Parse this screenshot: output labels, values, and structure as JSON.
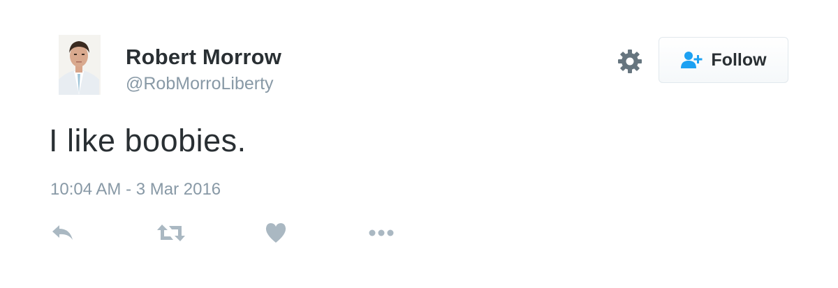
{
  "author": {
    "display_name": "Robert Morrow",
    "handle": "@RobMorroLiberty"
  },
  "header": {
    "follow_label": "Follow",
    "settings_icon": "gear-icon",
    "follow_icon": "add-user-icon"
  },
  "tweet": {
    "text": "I like boobies.",
    "timestamp": "10:04 AM - 3 Mar 2016"
  },
  "actions": [
    {
      "name": "reply",
      "icon": "reply-icon"
    },
    {
      "name": "retweet",
      "icon": "retweet-icon"
    },
    {
      "name": "like",
      "icon": "heart-icon"
    },
    {
      "name": "more",
      "icon": "more-dots-icon"
    }
  ],
  "colors": {
    "text_primary": "#292f33",
    "text_secondary": "#8899a6",
    "accent_blue": "#1da1f2",
    "icon_gray": "#aab8c2",
    "button_border": "#e1e8ed"
  }
}
